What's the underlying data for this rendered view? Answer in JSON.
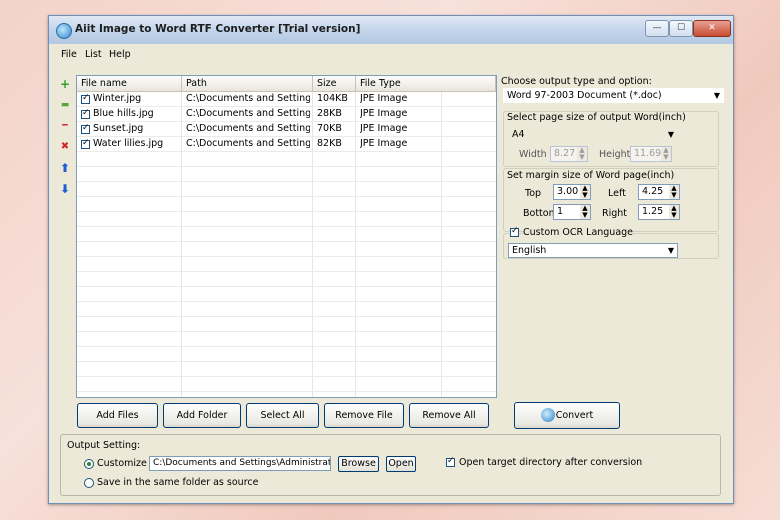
{
  "window": {
    "title": "Aiit Image to Word RTF Converter [Trial version]",
    "minimize_glyph": "—",
    "maximize_glyph": "☐",
    "close_glyph": "✕"
  },
  "menu": [
    "File",
    "List",
    "Help"
  ],
  "toolbar_icons": [
    {
      "name": "add-icon",
      "glyph": "+",
      "color": "#2ea02e"
    },
    {
      "name": "add-folder-icon",
      "glyph": "▬",
      "color": "#5aa63a"
    },
    {
      "name": "remove-icon",
      "glyph": "━",
      "color": "#d02a2a"
    },
    {
      "name": "delete-all-icon",
      "glyph": "✖",
      "color": "#d02a2a"
    },
    {
      "name": "move-up-icon",
      "glyph": "⬆",
      "color": "#1f5fd0"
    },
    {
      "name": "move-down-icon",
      "glyph": "⬇",
      "color": "#1f5fd0"
    }
  ],
  "file_table": {
    "columns": [
      "File name",
      "Path",
      "Size",
      "File Type"
    ],
    "rows": [
      {
        "checked": true,
        "name": "Winter.jpg",
        "path": "C:\\Documents and Setting...",
        "size": "104KB",
        "type": "JPE Image"
      },
      {
        "checked": true,
        "name": "Blue hills.jpg",
        "path": "C:\\Documents and Setting...",
        "size": "28KB",
        "type": "JPE Image"
      },
      {
        "checked": true,
        "name": "Sunset.jpg",
        "path": "C:\\Documents and Setting...",
        "size": "70KB",
        "type": "JPE Image"
      },
      {
        "checked": true,
        "name": "Water lilies.jpg",
        "path": "C:\\Documents and Setting...",
        "size": "82KB",
        "type": "JPE Image"
      }
    ]
  },
  "buttons": {
    "add_files": "Add Files",
    "add_folder": "Add Folder",
    "select_all": "Select All",
    "remove_file": "Remove File",
    "remove_all": "Remove All",
    "convert": "Convert"
  },
  "options": {
    "output_type_label": "Choose output type and option:",
    "output_type_value": "Word 97-2003 Document (*.doc)",
    "page_size_label": "Select page size of output Word(inch)",
    "page_size_value": "A4",
    "width_label": "Width",
    "width_value": "8.27",
    "height_label": "Height",
    "height_value": "11.69",
    "margin_label": "Set margin size of Word page(inch)",
    "top_label": "Top",
    "top_value": "3.00",
    "left_label": "Left",
    "left_value": "4.25",
    "bottom_label": "Bottom",
    "bottom_value": "1",
    "right_label": "Right",
    "right_value": "1.25",
    "ocr_checked": true,
    "ocr_label": "Custom OCR Language",
    "ocr_value": "English"
  },
  "output_setting": {
    "label": "Output Setting:",
    "customize_label": "Customize",
    "customize_selected": true,
    "path": "C:\\Documents and Settings\\Administrator\\",
    "browse": "Browse",
    "open": "Open",
    "open_target_checked": true,
    "open_target_label": "Open target directory after conversion",
    "same_folder_label": "Save in the same folder as source"
  }
}
